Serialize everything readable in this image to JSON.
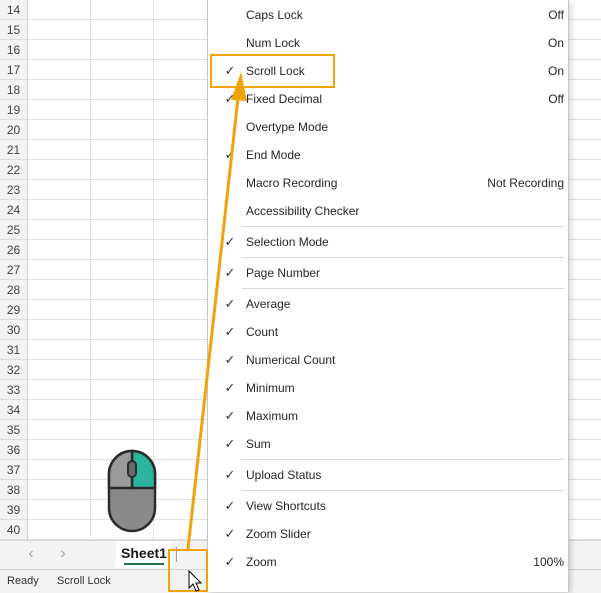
{
  "row_numbers": [
    "14",
    "15",
    "16",
    "17",
    "18",
    "19",
    "20",
    "21",
    "22",
    "23",
    "24",
    "25",
    "26",
    "27",
    "28",
    "29",
    "30",
    "31",
    "32",
    "33",
    "34",
    "35",
    "36",
    "37",
    "38",
    "39",
    "40"
  ],
  "sheet_tab": {
    "label": "Sheet1"
  },
  "nav": {
    "prev_icon": "‹",
    "next_icon": "›"
  },
  "status_bar": {
    "ready": "Ready",
    "scroll_lock": "Scroll Lock"
  },
  "menu": {
    "items": [
      {
        "label": "Caps Lock",
        "value": "Off",
        "checked": false
      },
      {
        "label": "Num Lock",
        "value": "On",
        "checked": false
      },
      {
        "label": "Scroll Lock",
        "value": "On",
        "checked": true
      },
      {
        "label": "Fixed Decimal",
        "value": "Off",
        "checked": true
      },
      {
        "label": "Overtype Mode",
        "value": "",
        "checked": false
      },
      {
        "label": "End Mode",
        "value": "",
        "checked": true
      },
      {
        "label": "Macro Recording",
        "value": "Not Recording",
        "checked": false
      },
      {
        "label": "Accessibility Checker",
        "value": "",
        "checked": false
      },
      {
        "label": "Selection Mode",
        "value": "",
        "checked": true
      },
      {
        "label": "Page Number",
        "value": "",
        "checked": true
      },
      {
        "label": "Average",
        "value": "",
        "checked": true
      },
      {
        "label": "Count",
        "value": "",
        "checked": true
      },
      {
        "label": "Numerical Count",
        "value": "",
        "checked": true
      },
      {
        "label": "Minimum",
        "value": "",
        "checked": true
      },
      {
        "label": "Maximum",
        "value": "",
        "checked": true
      },
      {
        "label": "Sum",
        "value": "",
        "checked": true
      },
      {
        "label": "Upload Status",
        "value": "",
        "checked": true
      },
      {
        "label": "View Shortcuts",
        "value": "",
        "checked": true
      },
      {
        "label": "Zoom Slider",
        "value": "",
        "checked": true
      },
      {
        "label": "Zoom",
        "value": "100%",
        "checked": true
      }
    ],
    "check_glyph": "✓"
  },
  "colors": {
    "highlight": "#f0a30a",
    "accent": "#217346",
    "mouse_button": "#2bb59a"
  },
  "icons": {
    "mouse": "mouse-icon",
    "cursor": "cursor-arrow-icon"
  }
}
